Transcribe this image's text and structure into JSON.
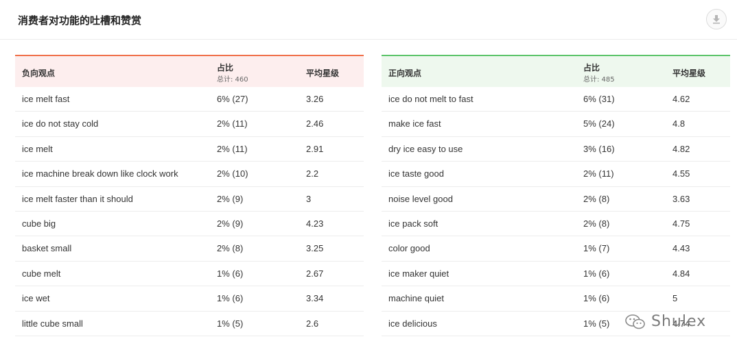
{
  "header": {
    "title": "消费者对功能的吐槽和赞赏",
    "download_icon": "download-icon"
  },
  "negative": {
    "col_opinion": "负向观点",
    "col_share": "占比",
    "col_total": "总计: 460",
    "col_rating": "平均星级",
    "accent": "#f0704a",
    "rows": [
      {
        "opinion": "ice melt fast",
        "share": "6% (27)",
        "rating": "3.26"
      },
      {
        "opinion": "ice do not stay cold",
        "share": "2% (11)",
        "rating": "2.46"
      },
      {
        "opinion": "ice melt",
        "share": "2% (11)",
        "rating": "2.91"
      },
      {
        "opinion": "ice machine break down like clock work",
        "share": "2% (10)",
        "rating": "2.2"
      },
      {
        "opinion": "ice melt faster than it should",
        "share": "2% (9)",
        "rating": "3"
      },
      {
        "opinion": "cube big",
        "share": "2% (9)",
        "rating": "4.23"
      },
      {
        "opinion": "basket small",
        "share": "2% (8)",
        "rating": "3.25"
      },
      {
        "opinion": "cube melt",
        "share": "1% (6)",
        "rating": "2.67"
      },
      {
        "opinion": "ice wet",
        "share": "1% (6)",
        "rating": "3.34"
      },
      {
        "opinion": "little cube small",
        "share": "1% (5)",
        "rating": "2.6"
      }
    ]
  },
  "positive": {
    "col_opinion": "正向观点",
    "col_share": "占比",
    "col_total": "总计: 485",
    "col_rating": "平均星级",
    "accent": "#5cc46a",
    "rows": [
      {
        "opinion": "ice do not melt to fast",
        "share": "6% (31)",
        "rating": "4.62"
      },
      {
        "opinion": "make ice fast",
        "share": "5% (24)",
        "rating": "4.8"
      },
      {
        "opinion": "dry ice easy to use",
        "share": "3% (16)",
        "rating": "4.82"
      },
      {
        "opinion": "ice taste good",
        "share": "2% (11)",
        "rating": "4.55"
      },
      {
        "opinion": "noise level good",
        "share": "2% (8)",
        "rating": "3.63"
      },
      {
        "opinion": "ice pack soft",
        "share": "2% (8)",
        "rating": "4.75"
      },
      {
        "opinion": "color good",
        "share": "1% (7)",
        "rating": "4.43"
      },
      {
        "opinion": "ice maker quiet",
        "share": "1% (6)",
        "rating": "4.84"
      },
      {
        "opinion": "machine quiet",
        "share": "1% (6)",
        "rating": "5"
      },
      {
        "opinion": "ice delicious",
        "share": "1% (5)",
        "rating": "4.74"
      }
    ]
  },
  "watermark": {
    "text": "Shulex",
    "icon": "wechat-icon"
  }
}
